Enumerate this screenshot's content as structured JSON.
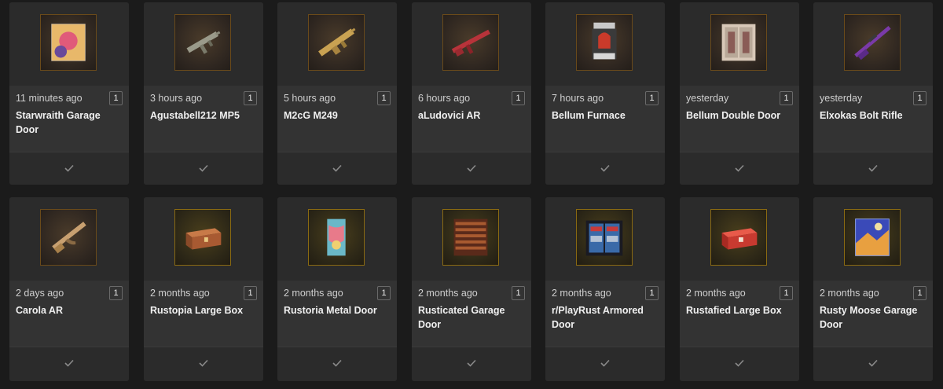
{
  "cards": [
    {
      "time": "11 minutes ago",
      "qty": "1",
      "name": "Starwraith Garage Door",
      "icon": "garage-door-art-icon"
    },
    {
      "time": "3 hours ago",
      "qty": "1",
      "name": "Agustabell212 MP5",
      "icon": "smg-icon"
    },
    {
      "time": "5 hours ago",
      "qty": "1",
      "name": "M2cG M249",
      "icon": "machine-gun-icon"
    },
    {
      "time": "6 hours ago",
      "qty": "1",
      "name": "aLudovici AR",
      "icon": "rifle-icon"
    },
    {
      "time": "7 hours ago",
      "qty": "1",
      "name": "Bellum Furnace",
      "icon": "furnace-icon"
    },
    {
      "time": "yesterday",
      "qty": "1",
      "name": "Bellum Double Door",
      "icon": "double-door-icon"
    },
    {
      "time": "yesterday",
      "qty": "1",
      "name": "Elxokas Bolt Rifle",
      "icon": "bolt-rifle-icon"
    },
    {
      "time": "2 days ago",
      "qty": "1",
      "name": "Carola AR",
      "icon": "ak-rifle-icon"
    },
    {
      "time": "2 months ago",
      "qty": "1",
      "name": "Rustopia Large Box",
      "icon": "large-box-icon"
    },
    {
      "time": "2 months ago",
      "qty": "1",
      "name": "Rustoria Metal Door",
      "icon": "metal-door-icon"
    },
    {
      "time": "2 months ago",
      "qty": "1",
      "name": "Rusticated Garage Door",
      "icon": "garage-door-icon"
    },
    {
      "time": "2 months ago",
      "qty": "1",
      "name": "r/PlayRust Armored Door",
      "icon": "armored-door-icon"
    },
    {
      "time": "2 months ago",
      "qty": "1",
      "name": "Rustafied Large Box",
      "icon": "large-box-icon"
    },
    {
      "time": "2 months ago",
      "qty": "1",
      "name": "Rusty Moose Garage Door",
      "icon": "garage-door-art-icon"
    }
  ]
}
